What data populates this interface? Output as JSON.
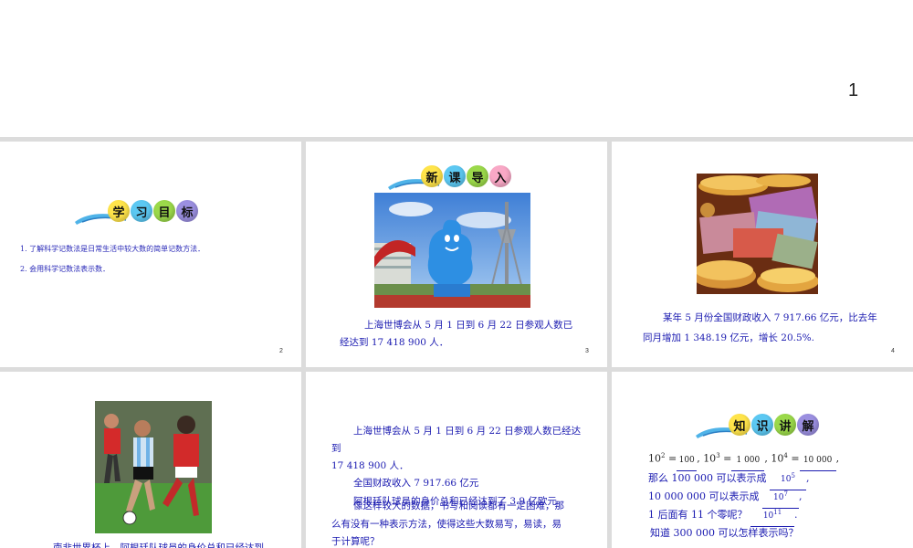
{
  "page": {
    "number": "1"
  },
  "slides": [
    {
      "num": "2",
      "banner": [
        "学",
        "习",
        "目",
        "标"
      ],
      "goals": [
        "1. 了解科学记数法是日常生活中较大数的简单记数方法．",
        "2. 会用科学记数法表示数．"
      ]
    },
    {
      "num": "3",
      "banner": [
        "新",
        "课",
        "导",
        "入"
      ],
      "text_line1": "上海世博会从 5 月 1 日到 6 月 22 日参观人数已",
      "text_line2": "经达到 17 418 900 人．"
    },
    {
      "num": "4",
      "text_line1": "某年 5 月份全国财政收入 7 917.66 亿元，比去年",
      "text_line2": "同月增加 1 348.19 亿元，增长 20.5%."
    },
    {
      "text_line1": "南非世界杯上，阿根廷队球员的身价总和已经达到"
    },
    {
      "lines": [
        "上海世博会从 5 月 1 日到 6 月 22 日参观人数已经达",
        "到",
        "17 418 900  人．",
        "全国财政收入 7 917.66 亿元",
        "阿根廷队球员的身价总和已经达到了 3.9 亿欧元",
        "像这样较大的数据，书写和阅读都有一定困难，那",
        "么有没有一种表示方法，使得这些大数易写，易读，易",
        "于计算呢？"
      ]
    },
    {
      "banner": [
        "知",
        "识",
        "讲",
        "解"
      ],
      "math": {
        "base": "10",
        "exp2": "2",
        "exp3": "3",
        "exp4": "4",
        "ans2": "100",
        "ans3": "1 000",
        "ans4": "10 000",
        "line2_prefix": "那么 100 000  可以表示成",
        "ans_100000": "10",
        "ans_100000_exp": "5",
        "line3_prefix": "10 000 000  可以表示成",
        "ans_10000000": "10",
        "ans_10000000_exp": "7",
        "line4_prefix": "1 后面有 11 个零呢？",
        "ans_11zeros": "10",
        "ans_11zeros_exp": "11",
        "line5": "知道 300 000 可以怎样表示吗？"
      }
    }
  ]
}
